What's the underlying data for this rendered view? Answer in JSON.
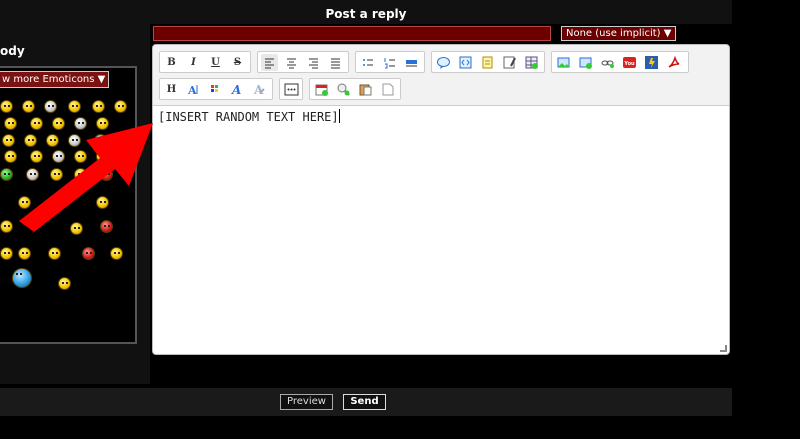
{
  "window": {
    "title": "Post a reply"
  },
  "sidebar": {
    "label": "ody",
    "more_emoticons_label": "w more Emoticons",
    "more_emoticons_caret": "▼"
  },
  "form": {
    "subject_value": "",
    "implicit_select_value": "None (use implicit) ▼"
  },
  "toolbar": {
    "bold": "B",
    "italic": "I",
    "underline": "U",
    "strike": "S",
    "heading": "H"
  },
  "editor": {
    "text": "[INSERT RANDOM TEXT HERE]"
  },
  "buttons": {
    "preview_label": "Preview",
    "send_label": "Send"
  },
  "colors": {
    "accent": "#7a1212",
    "annotation_arrow": "#ff0000"
  }
}
